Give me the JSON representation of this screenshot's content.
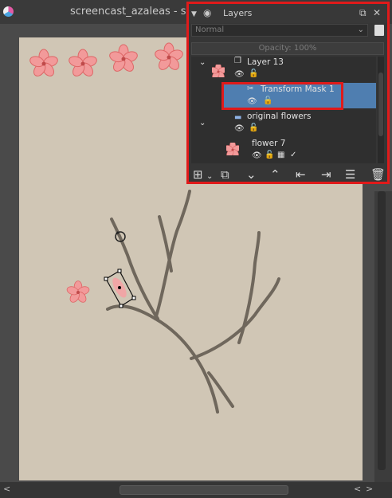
{
  "window": {
    "title": "screencast_azaleas - sc"
  },
  "layers_docker": {
    "title": "Layers",
    "blending_mode": "Normal",
    "opacity_label": "Opacity:  100%",
    "layers": [
      {
        "name": "Layer 13"
      },
      {
        "name": "Transform Mask 1",
        "selected": true
      },
      {
        "name": "original flowers"
      },
      {
        "name": "flower 7"
      }
    ]
  },
  "colors": {
    "highlight": "#e01a1a",
    "selection": "#4f7eb0",
    "canvas": "#d0c6b5",
    "flower": "#f29a9a"
  }
}
